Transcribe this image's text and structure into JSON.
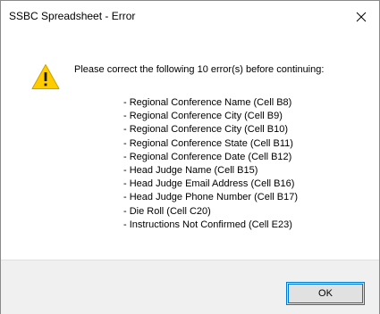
{
  "dialog": {
    "title": "SSBC Spreadsheet - Error",
    "message": "Please correct the following 10 error(s) before continuing:",
    "icon": "warning-icon",
    "errors": [
      "- Regional Conference Name (Cell B8)",
      "- Regional Conference City (Cell B9)",
      "- Regional Conference City (Cell B10)",
      "- Regional Conference State (Cell B11)",
      "- Regional Conference Date (Cell B12)",
      "- Head Judge Name (Cell B15)",
      "- Head Judge Email Address (Cell B16)",
      "- Head Judge Phone Number (Cell B17)",
      "- Die Roll (Cell C20)",
      "- Instructions Not Confirmed (Cell E23)"
    ],
    "ok_label": "OK",
    "close_icon": "close-icon"
  },
  "colors": {
    "warning_fill": "#ffcc00",
    "accent_border": "#0078d7",
    "footer_bg": "#f0f0f0",
    "button_bg": "#e1e1e1"
  }
}
